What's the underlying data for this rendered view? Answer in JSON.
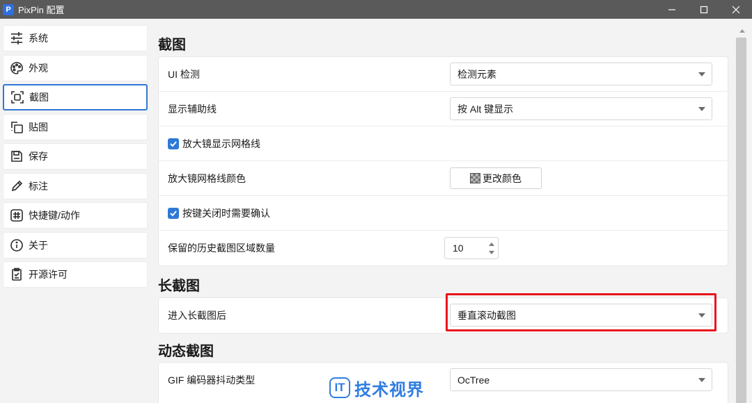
{
  "window": {
    "title": "PixPin 配置",
    "app_icon_letter": "P"
  },
  "sidebar": {
    "items": [
      {
        "label": "系统",
        "icon": "sliders-icon"
      },
      {
        "label": "外观",
        "icon": "palette-icon"
      },
      {
        "label": "截图",
        "icon": "screenshot-icon",
        "active": true
      },
      {
        "label": "贴图",
        "icon": "pin-copy-icon"
      },
      {
        "label": "保存",
        "icon": "save-icon"
      },
      {
        "label": "标注",
        "icon": "pencil-icon"
      },
      {
        "label": "快捷键/动作",
        "icon": "hash-icon"
      },
      {
        "label": "关于",
        "icon": "info-icon"
      },
      {
        "label": "开源许可",
        "icon": "clipboard-check-icon"
      }
    ]
  },
  "sections": {
    "screenshot": {
      "title": "截图",
      "ui_detect": {
        "label": "UI 检测",
        "value": "检测元素"
      },
      "guide_lines": {
        "label": "显示辅助线",
        "value": "按 Alt 键显示"
      },
      "magnifier_grid": {
        "label": "放大镜显示网格线",
        "checked": true
      },
      "grid_color": {
        "label": "放大镜网格线颜色",
        "button": "更改颜色"
      },
      "confirm_close": {
        "label": "按键关闭时需要确认",
        "checked": true
      },
      "history": {
        "label": "保留的历史截图区域数量",
        "value": "10"
      }
    },
    "long_screenshot": {
      "title": "长截图",
      "after_enter": {
        "label": "进入长截图后",
        "value": "垂直滚动截图"
      }
    },
    "dynamic_screenshot": {
      "title": "动态截图",
      "gif_dither": {
        "label": "GIF 编码器抖动类型",
        "value": "OcTree"
      }
    }
  },
  "watermark": {
    "logo": "IT",
    "text": "技术视界"
  },
  "colors": {
    "accent": "#2e78d6",
    "highlight": "#e8141b",
    "titlebar": "#5a5a5a"
  }
}
